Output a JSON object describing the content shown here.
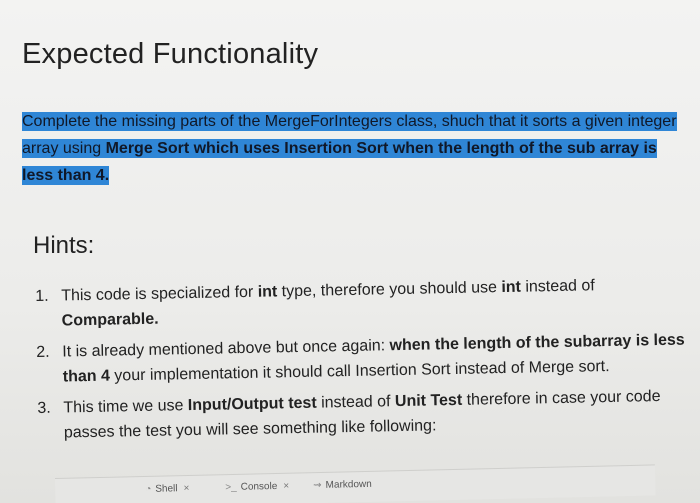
{
  "heading": "Expected Functionality",
  "intro": {
    "t1": "Complete the missing parts of the MergeForIntegers class, shuch that it sorts a given integer array using ",
    "b1": "Merge Sort which uses Insertion Sort when the length of the sub array is less than 4.",
    "highlight_color": "#2f86d6"
  },
  "hints_title": "Hints:",
  "hints": [
    {
      "num": "1.",
      "t1": "This code is specialized for ",
      "b1": "int",
      "t2": " type, therefore you should use ",
      "b2": "int",
      "t3": " instead of ",
      "b3": "Comparable."
    },
    {
      "num": "2.",
      "t1": "It is already mentioned above but once again: ",
      "b1": "when the length of the subarray is less than 4",
      "t2": " your implementation it should call Insertion Sort instead of Merge sort."
    },
    {
      "num": "3.",
      "t1": "This time we use ",
      "b1": "Input/Output test",
      "t2": " instead of ",
      "b2": "Unit Test",
      "t3": " therefore in case your code passes the test you will see something like following:"
    }
  ],
  "tabs": [
    {
      "icon": "◔",
      "label": "Shell",
      "close": "×"
    },
    {
      "icon": ">_",
      "label": "Console",
      "close": "×"
    },
    {
      "icon": "⇝",
      "label": "Markdown"
    }
  ]
}
